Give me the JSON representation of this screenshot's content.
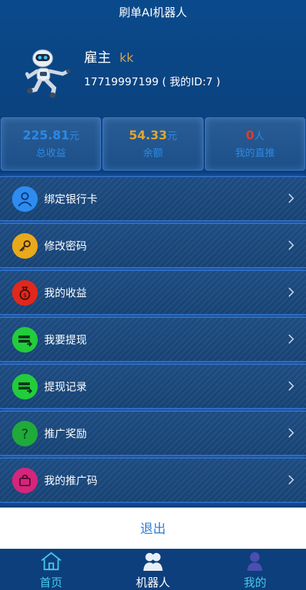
{
  "header": {
    "title": "刷单AI机器人",
    "user_name": "雇主",
    "user_nick": "kk",
    "phone_line": "17719997199 ( 我的ID:7 )"
  },
  "stats": [
    {
      "value": "225.81",
      "unit": "元",
      "label": "总收益",
      "color": "#2b8ae6"
    },
    {
      "value": "54.33",
      "unit": "元",
      "label": "余额",
      "color": "#e0a72c"
    },
    {
      "value": "0",
      "unit": "人",
      "label": "我的直推",
      "color": "#e03a2a"
    }
  ],
  "menu": [
    {
      "label": "绑定银行卡",
      "icon": "user-icon",
      "icon_color": "#2d8cf0"
    },
    {
      "label": "修改密码",
      "icon": "key-icon",
      "icon_color": "#e8a91c"
    },
    {
      "label": "我的收益",
      "icon": "money-bag-icon",
      "icon_color": "#e0281c"
    },
    {
      "label": "我要提现",
      "icon": "cash-out-icon",
      "icon_color": "#22cc3c"
    },
    {
      "label": "提现记录",
      "icon": "cash-record-icon",
      "icon_color": "#22cc3c"
    },
    {
      "label": "推广奖励",
      "icon": "question-icon",
      "icon_color": "#1faa3a"
    },
    {
      "label": "我的推广码",
      "icon": "bag-icon",
      "icon_color": "#d6257c"
    }
  ],
  "logout_label": "退出",
  "tabs": [
    {
      "label": "首页",
      "icon": "home-icon",
      "color": "#48c6ee"
    },
    {
      "label": "机器人",
      "icon": "robot-users-icon",
      "color": "#ffffff"
    },
    {
      "label": "我的",
      "icon": "person-icon",
      "color": "#48c6ee"
    }
  ]
}
